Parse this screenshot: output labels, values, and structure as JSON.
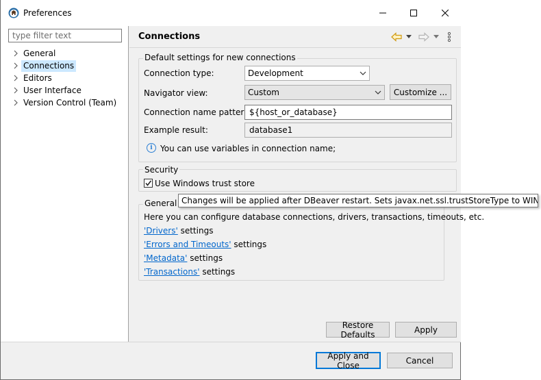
{
  "window": {
    "title": "Preferences",
    "controls": {
      "minimize": "—",
      "maximize": "☐",
      "close": "✕"
    }
  },
  "left": {
    "filter_placeholder": "type filter text",
    "tree": [
      {
        "label": "General",
        "selected": false
      },
      {
        "label": "Connections",
        "selected": true
      },
      {
        "label": "Editors",
        "selected": false
      },
      {
        "label": "User Interface",
        "selected": false
      },
      {
        "label": "Version Control (Team)",
        "selected": false
      }
    ]
  },
  "page": {
    "title": "Connections",
    "defaults_group": {
      "title": "Default settings for new connections",
      "connection_type_label": "Connection type:",
      "connection_type_value": "Development",
      "navigator_view_label": "Navigator view:",
      "navigator_view_value": "Custom",
      "customize_button": "Customize ...",
      "name_pattern_label": "Connection name pattern:",
      "name_pattern_value": "${host_or_database}",
      "example_label": "Example result:",
      "example_value": "database1",
      "info_text": "You can use variables in connection name;"
    },
    "security_group": {
      "title": "Security",
      "trust_store_label": "Use Windows trust store",
      "trust_store_checked": true
    },
    "general_group": {
      "title": "General",
      "description": "Here you can configure database connections, drivers, transactions, timeouts, etc.",
      "links": [
        {
          "link": "'Drivers'",
          "suffix": " settings"
        },
        {
          "link": "'Errors and Timeouts'",
          "suffix": " settings"
        },
        {
          "link": "'Metadata'",
          "suffix": " settings"
        },
        {
          "link": "'Transactions'",
          "suffix": " settings"
        }
      ]
    },
    "restore_defaults_button": "Restore Defaults",
    "apply_button": "Apply"
  },
  "tooltip": "Changes will be applied after DBeaver restart. Sets javax.net.ssl.trustStoreType to WINDOWS-ROOT",
  "footer": {
    "apply_close_button": "Apply and Close",
    "cancel_button": "Cancel"
  },
  "colors": {
    "accent": "#0078d7",
    "selection": "#cce8ff",
    "link": "#0066cc",
    "nav_arrow": "#e8a317"
  },
  "icons": {
    "app": "dbeaver-beaver-icon",
    "back": "back-arrow-icon",
    "forward": "forward-arrow-icon",
    "menu": "vertical-dots-icon",
    "info": "info-icon",
    "chevron": "chevron-right-icon"
  }
}
